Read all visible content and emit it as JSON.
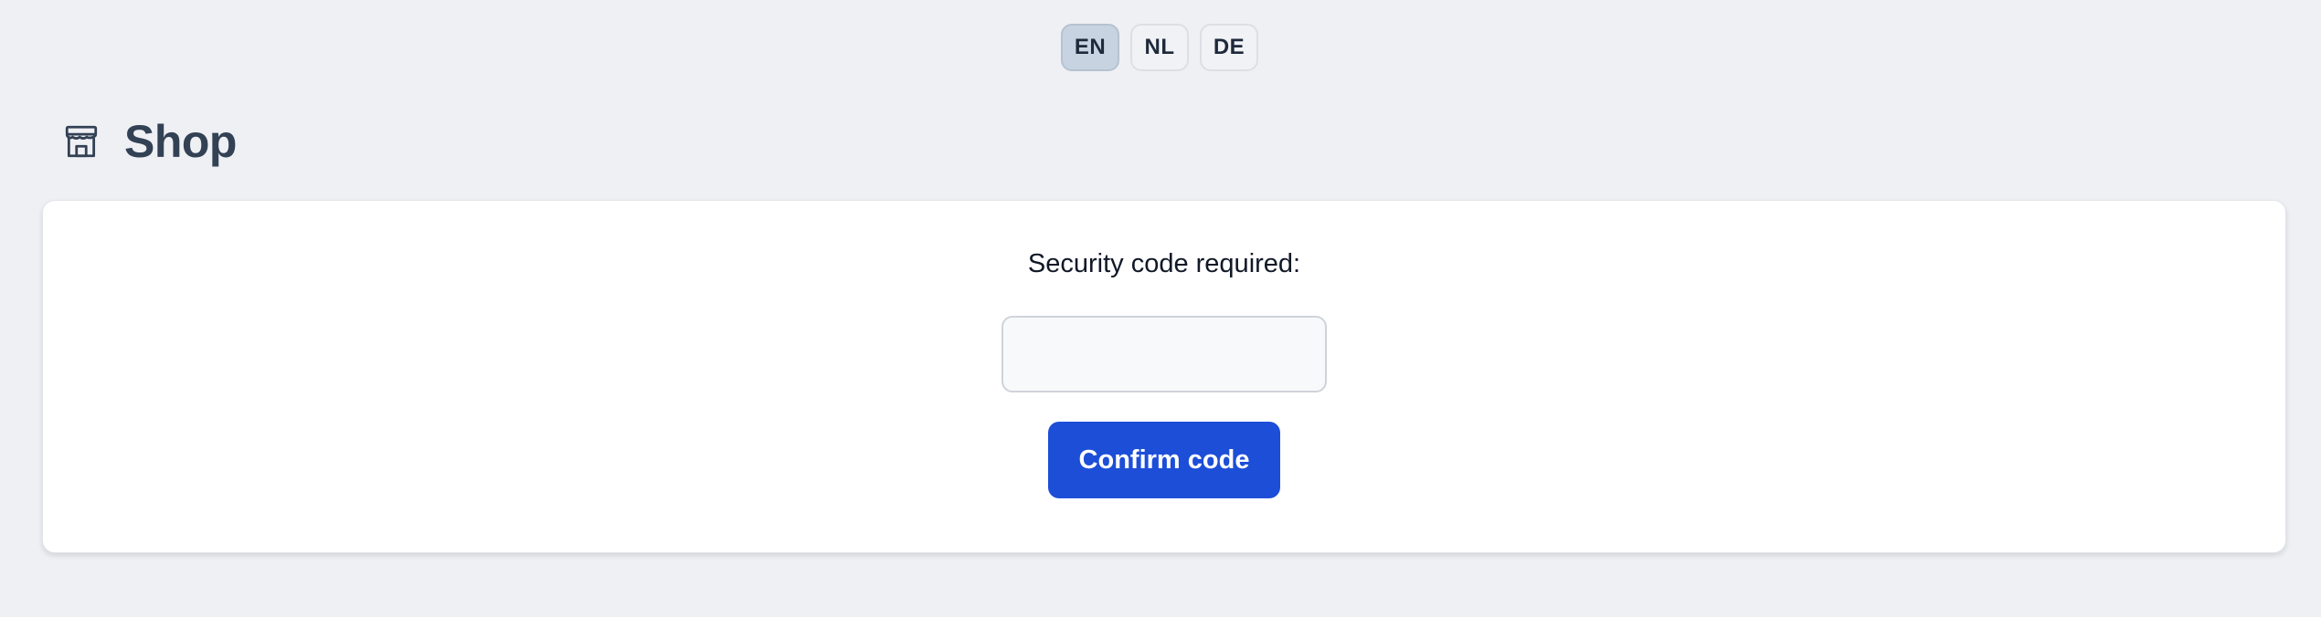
{
  "languages": [
    {
      "code": "EN",
      "active": true
    },
    {
      "code": "NL",
      "active": false
    },
    {
      "code": "DE",
      "active": false
    }
  ],
  "header": {
    "title": "Shop",
    "icon": "storefront-icon"
  },
  "verification": {
    "prompt": "Security code required:",
    "input_value": "",
    "input_placeholder": "",
    "confirm_label": "Confirm code"
  },
  "colors": {
    "background": "#eff0f4",
    "accent": "#1d4ed8",
    "active_language": "#c7d3e0",
    "title_text": "#334155"
  }
}
